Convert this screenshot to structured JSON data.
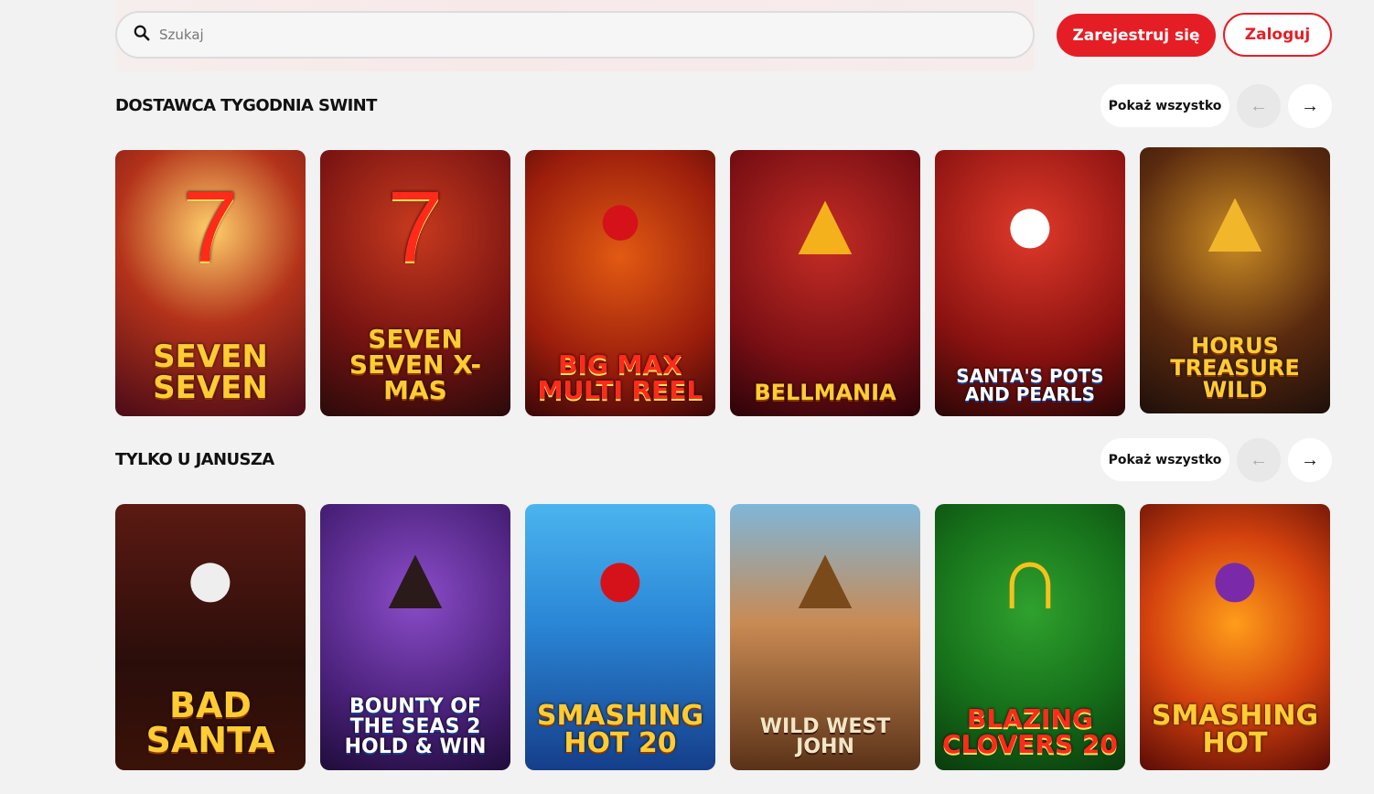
{
  "header": {
    "search_placeholder": "Szukaj",
    "register_label": "Zarejestruj się",
    "login_label": "Zaloguj"
  },
  "colors": {
    "accent": "#e51e25",
    "background": "#f2f2f2"
  },
  "sections": [
    {
      "title": "DOSTAWCA TYGODNIA SWINT",
      "show_all_label": "Pokaż wszystko",
      "games": [
        {
          "name": "Seven Seven"
        },
        {
          "name": "Seven Seven X-Mas"
        },
        {
          "name": "Big Max Multi Reel"
        },
        {
          "name": "Bellmania"
        },
        {
          "name": "Santa's Pots and Pearls"
        },
        {
          "name": "Horus Treasure Wild"
        }
      ]
    },
    {
      "title": "TYLKO U JANUSZA",
      "show_all_label": "Pokaż wszystko",
      "games": [
        {
          "name": "Bad Santa"
        },
        {
          "name": "Bounty of the Seas 2 Hold & Win"
        },
        {
          "name": "Smashing Hot 20"
        },
        {
          "name": "Wild West John"
        },
        {
          "name": "Blazing Clovers 20"
        },
        {
          "name": "Smashing Hot"
        }
      ]
    }
  ],
  "icons": {
    "search": "search-icon",
    "prev": "arrow-left-icon",
    "next": "arrow-right-icon"
  }
}
